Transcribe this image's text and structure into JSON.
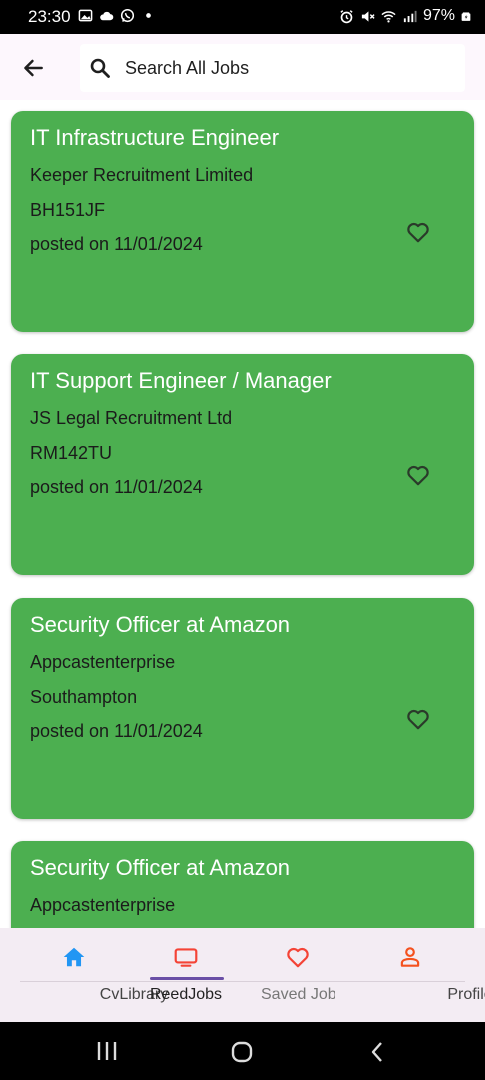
{
  "status_bar": {
    "time": "23:30",
    "battery": "97%",
    "icons": [
      "gallery-icon",
      "cloud-icon",
      "whatsapp-icon",
      "dot-icon",
      "alarm-icon",
      "mute-icon",
      "wifi-icon",
      "signal-icon",
      "battery-icon"
    ]
  },
  "app_bar": {
    "back_icon": "arrow-back-icon",
    "search_icon": "search-icon",
    "search_text": "Search All Jobs"
  },
  "jobs": [
    {
      "title": "IT Infrastructure Engineer",
      "company": "Keeper Recruitment Limited",
      "location": "BH151JF",
      "posted": "posted on 11/01/2024"
    },
    {
      "title": "IT Support Engineer / Manager",
      "company": "JS Legal Recruitment Ltd",
      "location": "RM142TU",
      "posted": "posted on 11/01/2024"
    },
    {
      "title": "Security Officer at Amazon",
      "company": "Appcastenterprise",
      "location": "Southampton",
      "posted": "posted on 11/01/2024"
    },
    {
      "title": "Security Officer at Amazon",
      "company": "Appcastenterprise",
      "location": "",
      "posted": ""
    }
  ],
  "bottom_nav": {
    "items": [
      {
        "label": "CvLibrary",
        "icon": "home-icon",
        "color": "#2196f3"
      },
      {
        "label": "ReedJobs",
        "icon": "tv-icon",
        "color": "#f44336",
        "selected": true
      },
      {
        "label": "Saved Jobs",
        "icon": "heart-icon",
        "color": "#f44336"
      },
      {
        "label": "Profile",
        "icon": "person-icon",
        "color": "#f4511e"
      }
    ]
  },
  "colors": {
    "card_green": "#4caf50",
    "nav_background": "#f3ecf3",
    "indicator": "#6a4fa6"
  }
}
